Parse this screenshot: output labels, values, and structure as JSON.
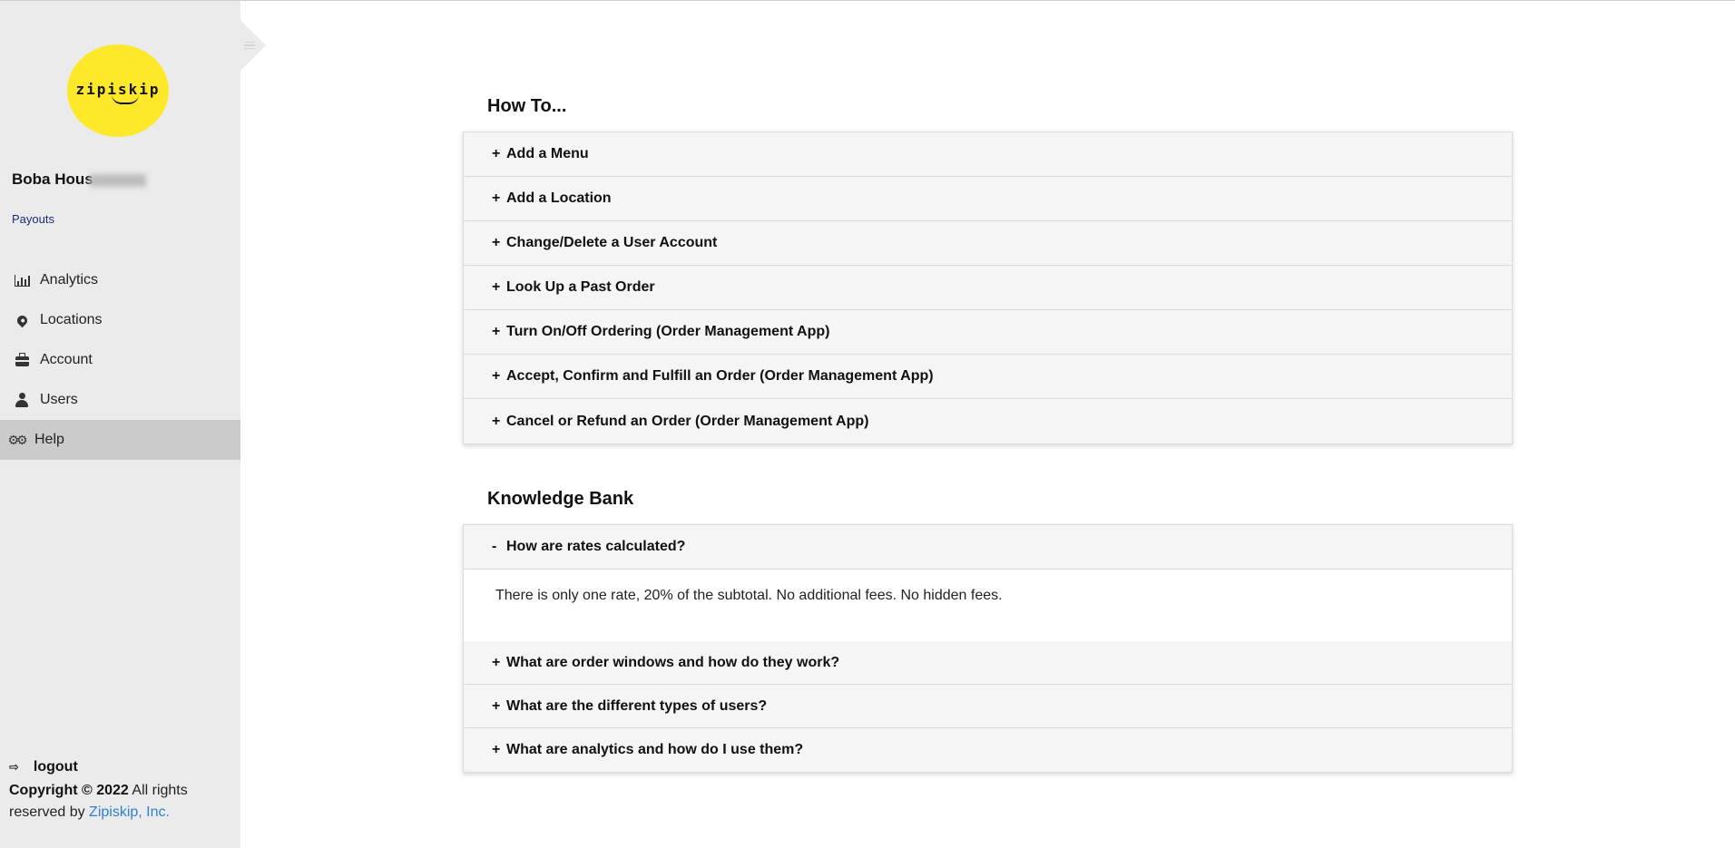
{
  "sidebar": {
    "logo_text": "zipiskip",
    "business_name": "Boba Hous",
    "payouts_label": "Payouts",
    "nav": [
      {
        "label": "Analytics",
        "icon": "bar-chart-icon"
      },
      {
        "label": "Locations",
        "icon": "map-pin-icon"
      },
      {
        "label": "Account",
        "icon": "briefcase-icon"
      },
      {
        "label": "Users",
        "icon": "user-icon"
      },
      {
        "label": "Help",
        "icon": "gears-icon",
        "active": true
      }
    ],
    "logout_label": "logout",
    "copyright_bold": "Copyright © 2022",
    "copyright_rest": " All rights reserved by ",
    "copyright_link": "Zipiskip, Inc."
  },
  "howto": {
    "title": "How To...",
    "items": [
      {
        "sign": "+",
        "label": "Add a Menu"
      },
      {
        "sign": "+",
        "label": "Add a Location"
      },
      {
        "sign": "+",
        "label": "Change/Delete a User Account"
      },
      {
        "sign": "+",
        "label": "Look Up a Past Order"
      },
      {
        "sign": "+",
        "label": "Turn On/Off Ordering (Order Management App)"
      },
      {
        "sign": "+",
        "label": "Accept, Confirm and Fulfill an Order (Order Management App)"
      },
      {
        "sign": "+",
        "label": "Cancel or Refund an Order (Order Management App)"
      }
    ]
  },
  "knowledge": {
    "title": "Knowledge Bank",
    "open_item": {
      "sign": "-",
      "label": "How are rates calculated?",
      "answer": "There is only one rate, 20% of the subtotal. No additional fees. No hidden fees."
    },
    "items": [
      {
        "sign": "+",
        "label": "What are order windows and how do they work?"
      },
      {
        "sign": "+",
        "label": "What are the different types of users?"
      },
      {
        "sign": "+",
        "label": "What are analytics and how do I use them?"
      }
    ]
  },
  "colors": {
    "sidebar_bg": "#ebebeb",
    "active_nav_bg": "#cbcbcb",
    "logo_yellow": "#fde92a",
    "payouts_link": "#1a2a7c",
    "copyright_link": "#2f80d1"
  }
}
